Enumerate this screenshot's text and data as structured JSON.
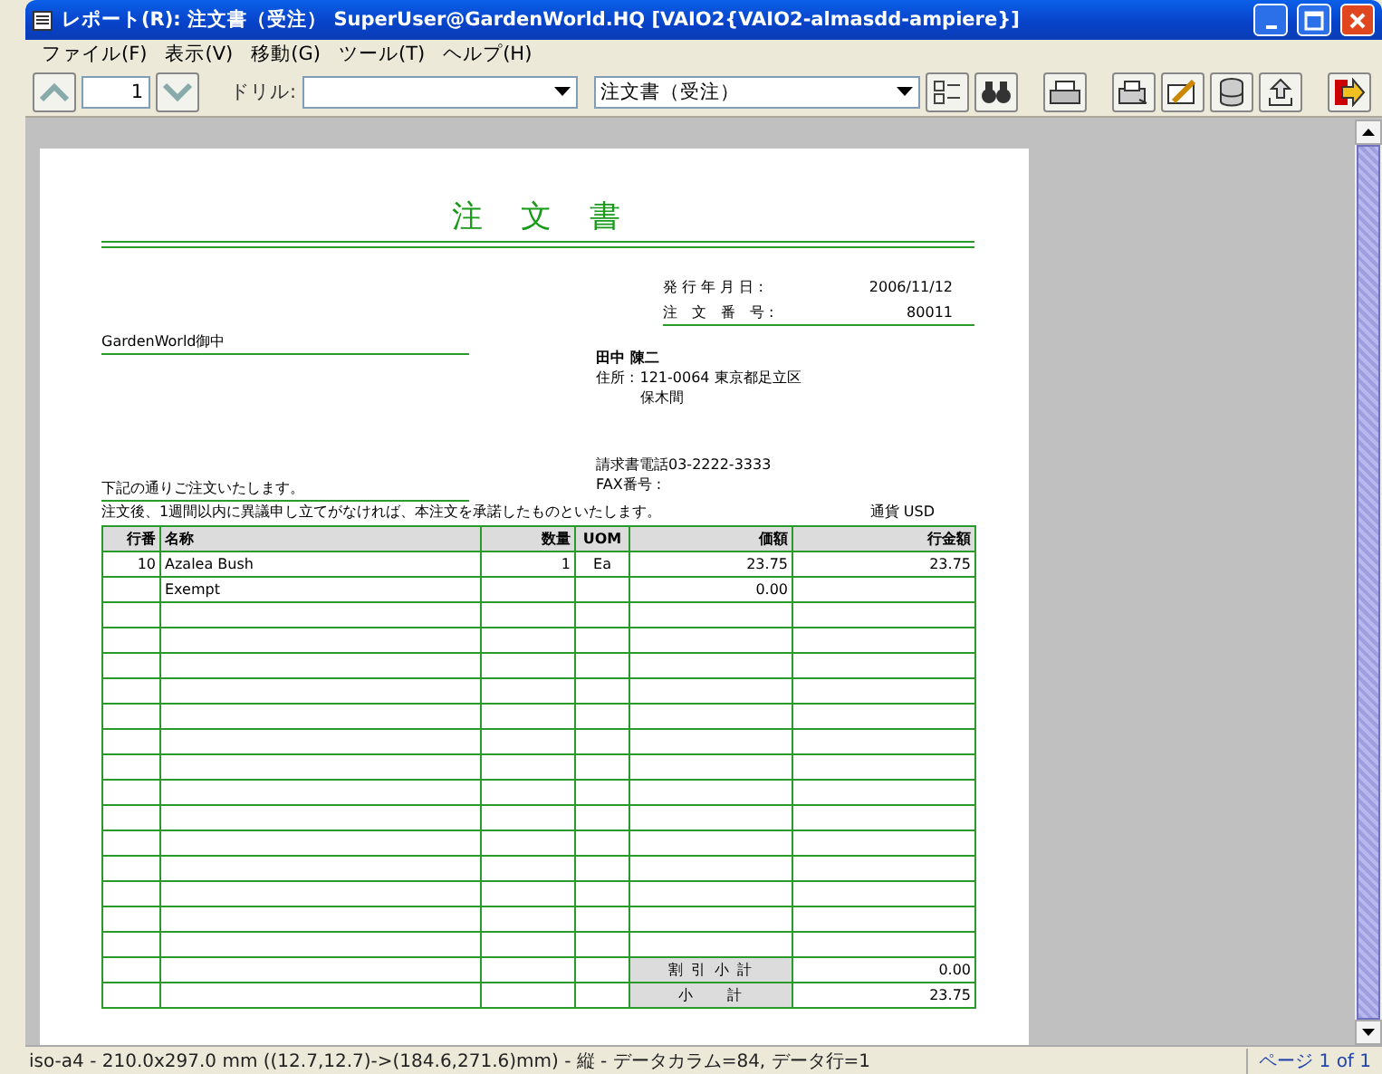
{
  "window": {
    "title": "レポート(R): 注文書（受注）  SuperUser@GardenWorld.HQ  [VAIO2{VAIO2-almasdd-ampiere}]"
  },
  "menu": [
    "ファイル(F)",
    "表示(V)",
    "移動(G)",
    "ツール(T)",
    "ヘルプ(H)"
  ],
  "toolbar": {
    "page_number": "1",
    "drill_label": "ドリル:",
    "report_select": "注文書（受注）"
  },
  "document": {
    "title": "注　文　書",
    "issue_date_label": "発 行 年 月 日 :",
    "issue_date": "2006/11/12",
    "order_no_label": "注　文　番　号 :",
    "order_no": "80011",
    "recipient": "GardenWorld御中",
    "sender_name": "田中 陳二",
    "address_label": "住所 :",
    "address_lines": [
      "121-0064 東京都足立区",
      "保木間"
    ],
    "phone": "請求書電話03-2222-3333",
    "fax_label": "FAX番号 :",
    "intro": "下記の通りご注文いたします。",
    "notice": "注文後、1週間以内に異議申し立てがなければ、本注文を承諾したものといたします。",
    "currency": "通貨 USD",
    "table": {
      "columns": [
        "行番",
        "名称",
        "数量",
        "UOM",
        "価額",
        "行金額"
      ],
      "rows": [
        {
          "line": "10",
          "name": "Azalea Bush",
          "qty": "1",
          "uom": "Ea",
          "price": "23.75",
          "amount": "23.75"
        },
        {
          "name": "Exempt",
          "price": "0.00"
        },
        {},
        {},
        {},
        {},
        {},
        {},
        {},
        {},
        {},
        {},
        {},
        {},
        {},
        {}
      ],
      "footer": [
        {
          "label": "割 引 小 計",
          "value": "0.00"
        },
        {
          "label": "小　　計",
          "value": "23.75"
        }
      ]
    }
  },
  "status_bar": {
    "text": "iso-a4 - 210.0x297.0 mm ((12.7,12.7)->(184.6,271.6)mm) - 縦 - データカラム=84, データ行=1",
    "page": "ページ 1 of 1"
  }
}
